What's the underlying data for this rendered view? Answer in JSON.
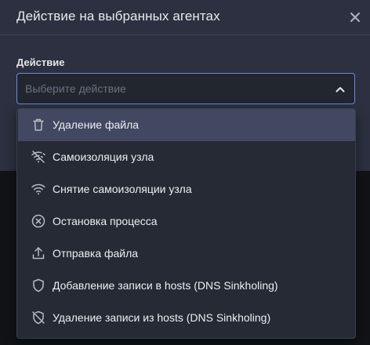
{
  "modal": {
    "title": "Действие на выбранных агентах",
    "close_icon": "close-icon"
  },
  "form": {
    "action_label": "Действие",
    "select": {
      "placeholder": "Выберите действие",
      "state": "open",
      "chevron_icon": "chevron-up-icon"
    }
  },
  "dropdown": {
    "options": [
      {
        "label": "Удаление файла",
        "icon": "trash-icon",
        "highlighted": true
      },
      {
        "label": "Самоизоляция узла",
        "icon": "wifi-off-icon",
        "highlighted": false
      },
      {
        "label": "Снятие самоизоляции узла",
        "icon": "wifi-icon",
        "highlighted": false
      },
      {
        "label": "Остановка процесса",
        "icon": "circle-x-icon",
        "highlighted": false
      },
      {
        "label": "Отправка файла",
        "icon": "upload-icon",
        "highlighted": false
      },
      {
        "label": "Добавление записи в hosts (DNS Sinkholing)",
        "icon": "shield-icon",
        "highlighted": false
      },
      {
        "label": "Удаление записи из hosts (DNS Sinkholing)",
        "icon": "shield-off-icon",
        "highlighted": false
      }
    ]
  },
  "colors": {
    "modal_bg": "#2c3040",
    "highlight_bg": "#424861",
    "focus_border": "#6f8ad8",
    "dropdown_bg": "#262a34"
  }
}
